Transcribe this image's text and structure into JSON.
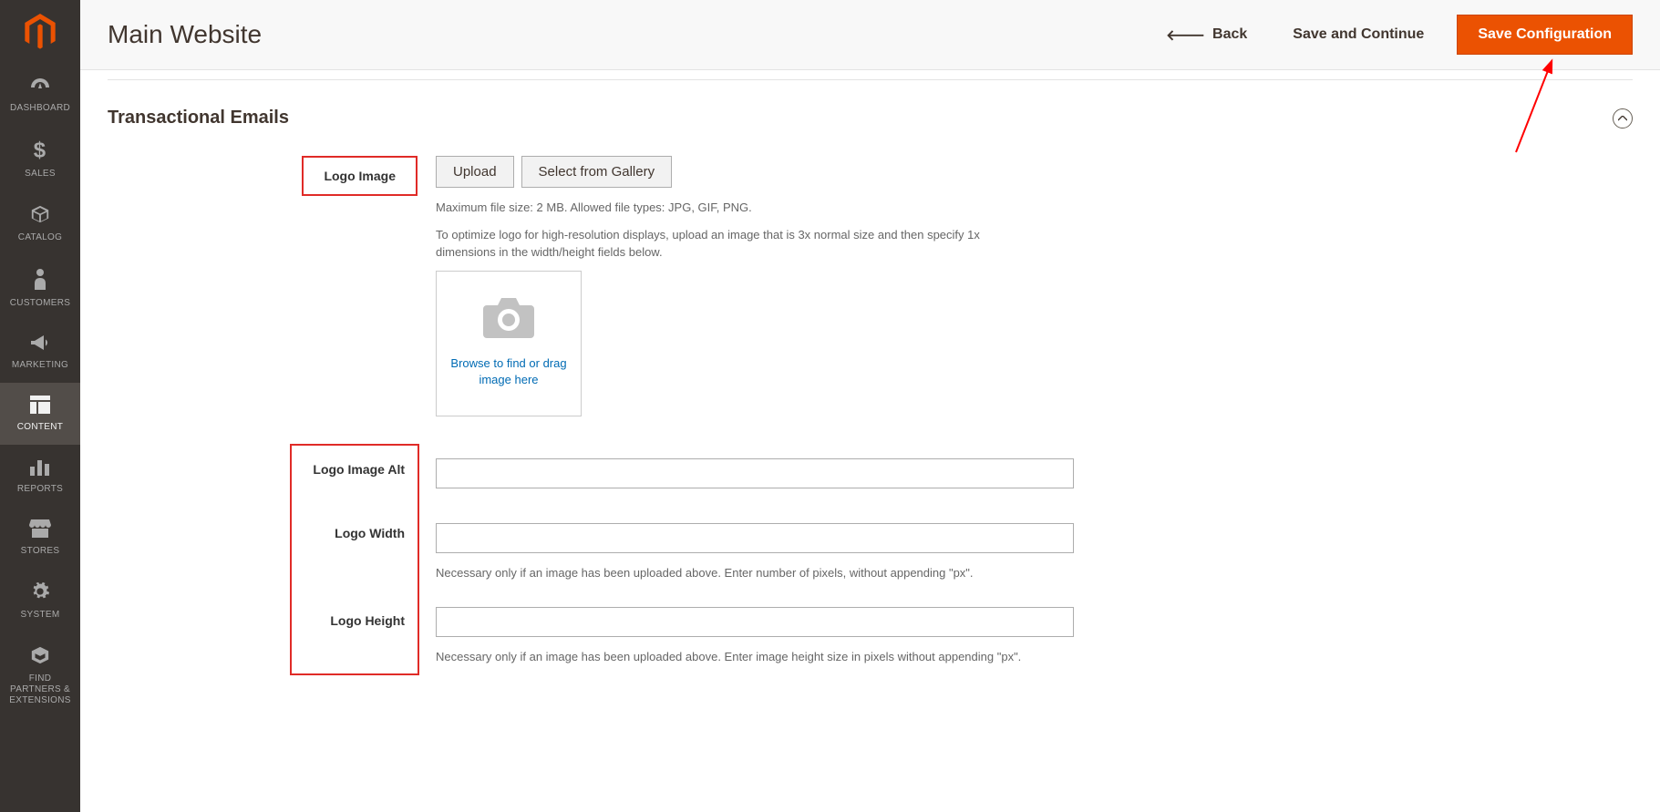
{
  "header": {
    "page_title": "Main Website",
    "back_label": "Back",
    "save_continue_label": "Save and Continue",
    "save_config_label": "Save Configuration"
  },
  "sidebar": {
    "items": [
      {
        "label": "DASHBOARD"
      },
      {
        "label": "SALES"
      },
      {
        "label": "CATALOG"
      },
      {
        "label": "CUSTOMERS"
      },
      {
        "label": "MARKETING"
      },
      {
        "label": "CONTENT"
      },
      {
        "label": "REPORTS"
      },
      {
        "label": "STORES"
      },
      {
        "label": "SYSTEM"
      },
      {
        "label": "FIND PARTNERS & EXTENSIONS"
      }
    ]
  },
  "section": {
    "title": "Transactional Emails"
  },
  "fields": {
    "logo_image_label": "Logo Image",
    "upload_label": "Upload",
    "gallery_label": "Select from Gallery",
    "file_help": "Maximum file size: 2 MB. Allowed file types: JPG, GIF, PNG.",
    "resolution_help": "To optimize logo for high-resolution displays, upload an image that is 3x normal size and then specify 1x dimensions in the width/height fields below.",
    "browse_text": "Browse to find or drag image here",
    "logo_alt_label": "Logo Image Alt",
    "logo_alt_value": "",
    "logo_width_label": "Logo Width",
    "logo_width_value": "",
    "logo_width_help": "Necessary only if an image has been uploaded above. Enter number of pixels, without appending \"px\".",
    "logo_height_label": "Logo Height",
    "logo_height_value": "",
    "logo_height_help": "Necessary only if an image has been uploaded above. Enter image height size in pixels without appending \"px\"."
  }
}
